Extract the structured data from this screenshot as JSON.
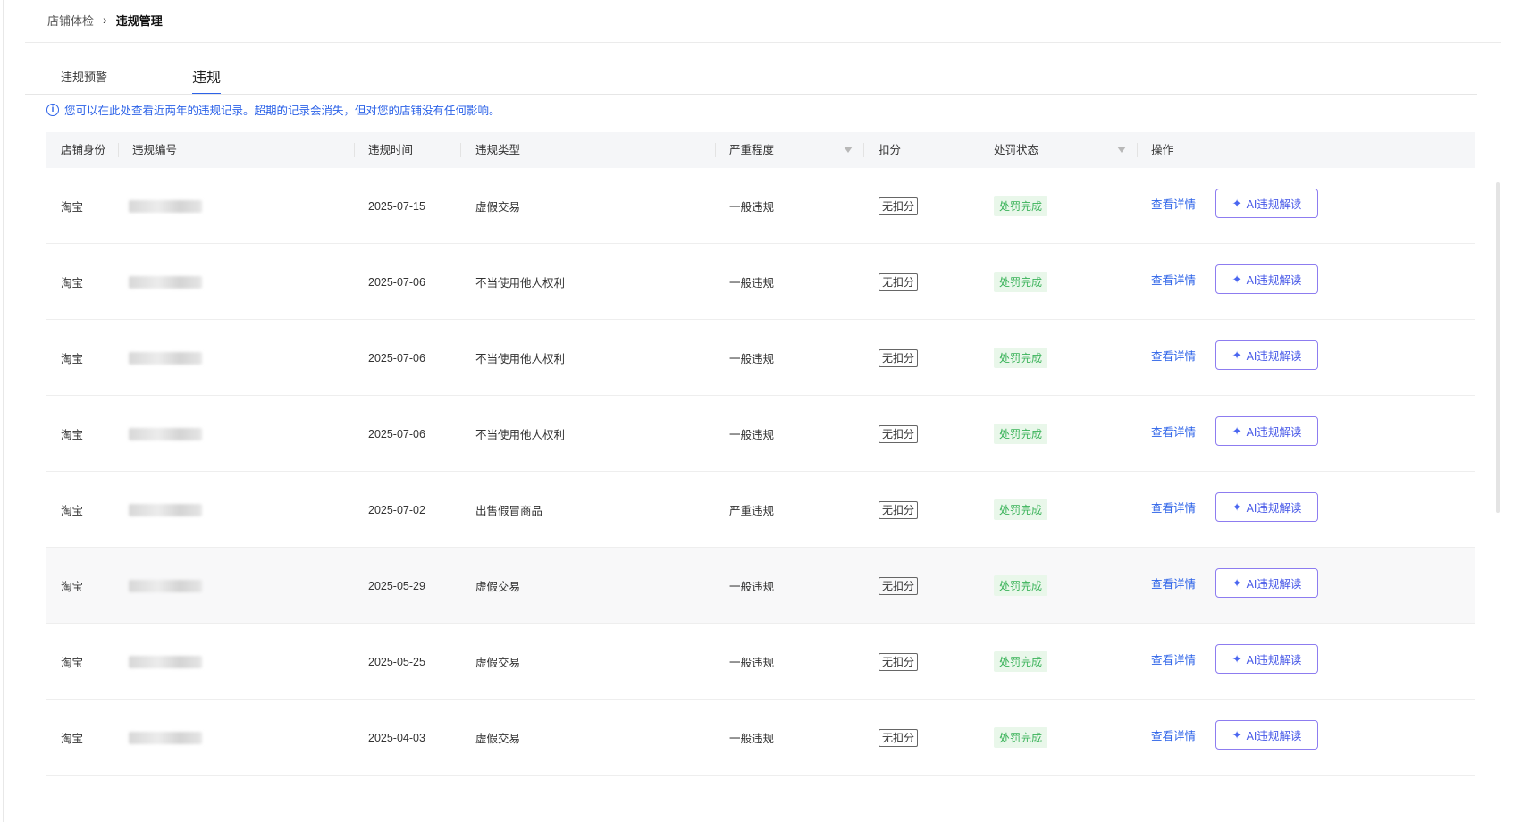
{
  "breadcrumb": {
    "parent": "店铺体检",
    "separator": "›",
    "current": "违规管理"
  },
  "tabs": [
    {
      "label": "违规预警",
      "active": false
    },
    {
      "label": "违规",
      "active": true
    }
  ],
  "notice": {
    "icon": "info-icon",
    "text": "您可以在此处查看近两年的违规记录。超期的记录会消失，但对您的店铺没有任何影响。"
  },
  "table": {
    "headers": {
      "shop_identity": "店铺身份",
      "violation_no": "违规编号",
      "violation_time": "违规时间",
      "violation_type": "违规类型",
      "severity": "严重程度",
      "deduction": "扣分",
      "penalty_status": "处罚状态",
      "action": "操作"
    },
    "rows": [
      {
        "shop": "淘宝",
        "time": "2025-07-15",
        "type": "虚假交易",
        "severity": "一般违规",
        "deduction": "无扣分",
        "status": "处罚完成",
        "detail": "查看详情",
        "ai": "AI违规解读"
      },
      {
        "shop": "淘宝",
        "time": "2025-07-06",
        "type": "不当使用他人权利",
        "severity": "一般违规",
        "deduction": "无扣分",
        "status": "处罚完成",
        "detail": "查看详情",
        "ai": "AI违规解读"
      },
      {
        "shop": "淘宝",
        "time": "2025-07-06",
        "type": "不当使用他人权利",
        "severity": "一般违规",
        "deduction": "无扣分",
        "status": "处罚完成",
        "detail": "查看详情",
        "ai": "AI违规解读"
      },
      {
        "shop": "淘宝",
        "time": "2025-07-06",
        "type": "不当使用他人权利",
        "severity": "一般违规",
        "deduction": "无扣分",
        "status": "处罚完成",
        "detail": "查看详情",
        "ai": "AI违规解读"
      },
      {
        "shop": "淘宝",
        "time": "2025-07-02",
        "type": "出售假冒商品",
        "severity": "严重违规",
        "deduction": "无扣分",
        "status": "处罚完成",
        "detail": "查看详情",
        "ai": "AI违规解读"
      },
      {
        "shop": "淘宝",
        "time": "2025-05-29",
        "type": "虚假交易",
        "severity": "一般违规",
        "deduction": "无扣分",
        "status": "处罚完成",
        "detail": "查看详情",
        "ai": "AI违规解读"
      },
      {
        "shop": "淘宝",
        "time": "2025-05-25",
        "type": "虚假交易",
        "severity": "一般违规",
        "deduction": "无扣分",
        "status": "处罚完成",
        "detail": "查看详情",
        "ai": "AI违规解读"
      },
      {
        "shop": "淘宝",
        "time": "2025-04-03",
        "type": "虚假交易",
        "severity": "一般违规",
        "deduction": "无扣分",
        "status": "处罚完成",
        "detail": "查看详情",
        "ai": "AI违规解读"
      }
    ]
  },
  "colors": {
    "accent": "#2d63e8",
    "success_bg": "#e9f7ea",
    "success_text": "#3bb35a",
    "ai_border": "#8d7cf0"
  }
}
